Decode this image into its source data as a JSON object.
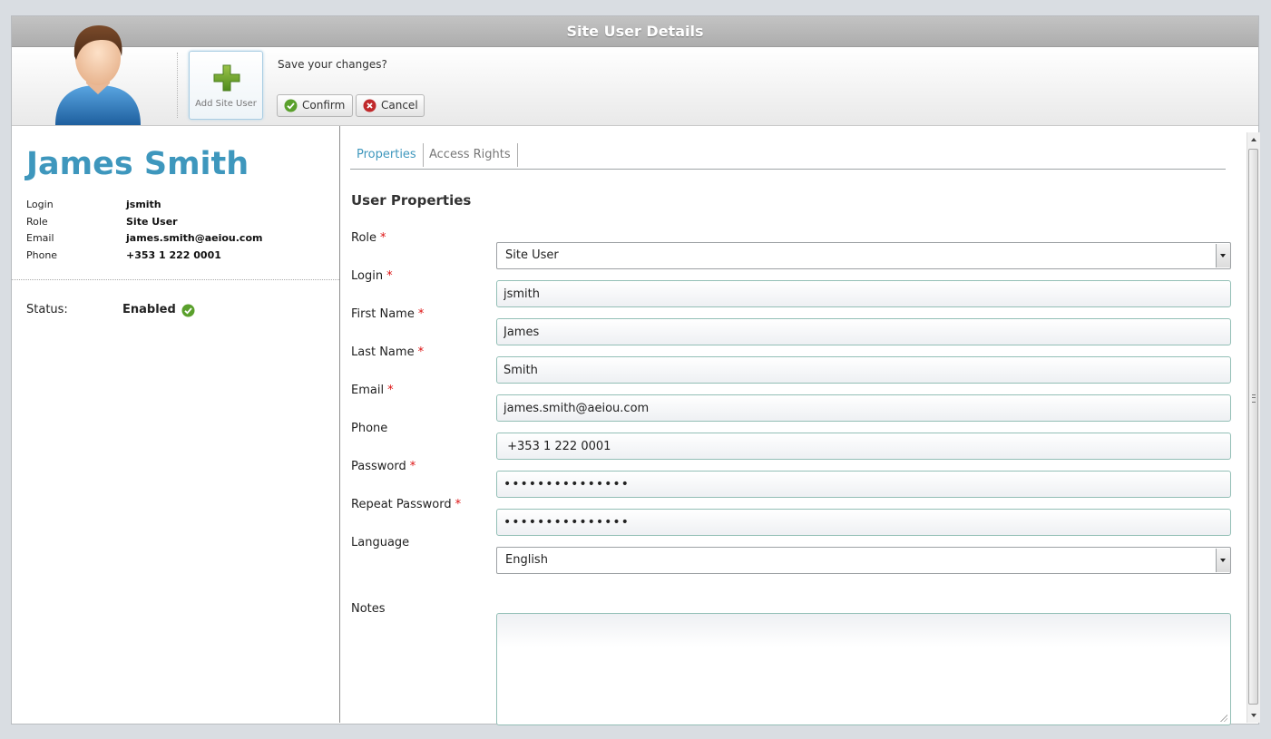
{
  "window": {
    "title": "Site User Details"
  },
  "toolbar": {
    "add_label": "Add Site User",
    "save_prompt": "Save your changes?",
    "confirm_label": "Confirm",
    "cancel_label": "Cancel"
  },
  "summary": {
    "name": "James Smith",
    "rows": [
      {
        "key": "Login",
        "value": "jsmith"
      },
      {
        "key": "Role",
        "value": "Site User"
      },
      {
        "key": "Email",
        "value": "james.smith@aeiou.com"
      },
      {
        "key": "Phone",
        "value": "+353 1 222 0001"
      }
    ],
    "status_label": "Status:",
    "status_value": "Enabled"
  },
  "tabs": [
    {
      "label": "Properties",
      "active": true
    },
    {
      "label": "Access Rights",
      "active": false
    }
  ],
  "form": {
    "section_title": "User Properties",
    "role": {
      "label": "Role",
      "value": "Site User",
      "required": "*"
    },
    "login": {
      "label": "Login",
      "value": "jsmith",
      "required": "*"
    },
    "first_name": {
      "label": "First Name",
      "value": "James",
      "required": "*"
    },
    "last_name": {
      "label": "Last Name",
      "value": "Smith",
      "required": "*"
    },
    "email": {
      "label": "Email",
      "value": "james.smith@aeiou.com",
      "required": "*"
    },
    "phone": {
      "label": "Phone",
      "value": " +353 1 222 0001"
    },
    "password": {
      "label": "Password",
      "value": "•••••••••••••••",
      "required": "*"
    },
    "repeat_password": {
      "label": "Repeat Password",
      "value": "•••••••••••••••",
      "required": "*"
    },
    "language": {
      "label": "Language",
      "value": "English"
    },
    "notes": {
      "label": "Notes",
      "value": ""
    }
  },
  "colors": {
    "accent": "#3e97bd",
    "required": "#dd1111",
    "ok": "#5aa02c",
    "cancel": "#c0292b"
  },
  "icons": {
    "avatar": "user-avatar-icon",
    "add": "plus-icon",
    "confirm": "check-circle-icon",
    "cancel": "close-circle-icon",
    "status": "check-circle-icon"
  }
}
